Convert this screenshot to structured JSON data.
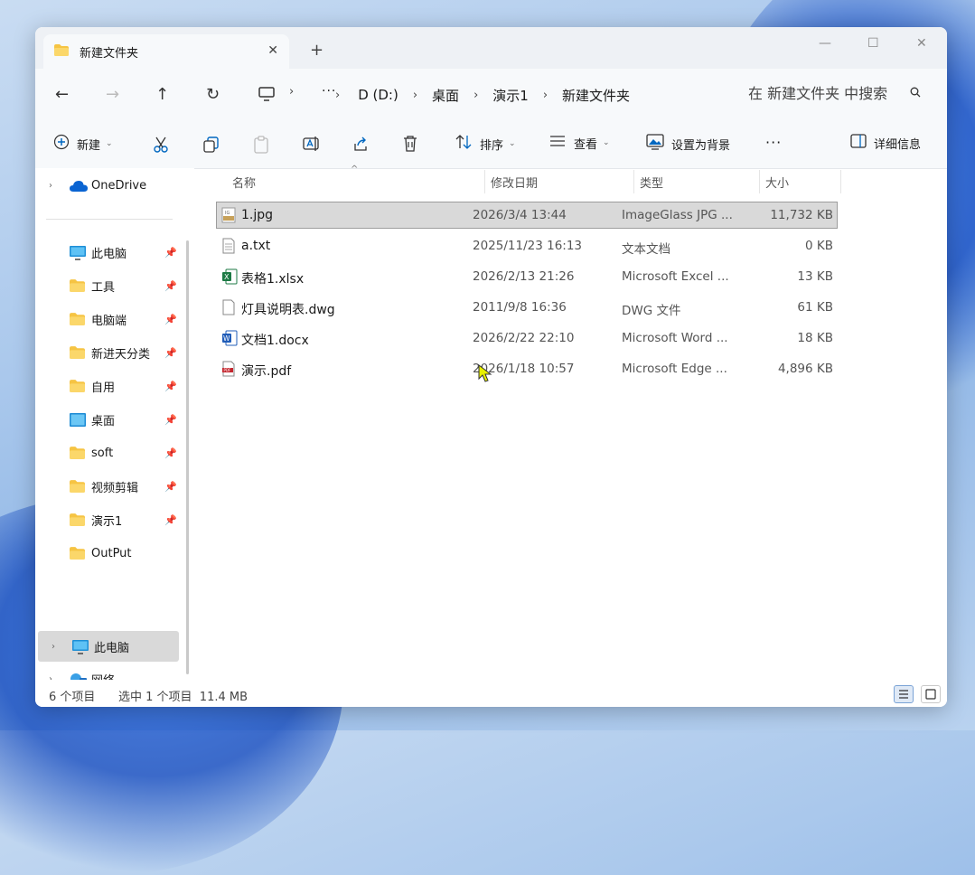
{
  "window": {
    "tab_title": "新建文件夹",
    "tab_close": "✕",
    "new_tab": "+",
    "min": "—",
    "max": "☐",
    "close": "✕"
  },
  "nav": {
    "back": "←",
    "forward": "→",
    "up": "↑",
    "refresh": "↻",
    "more": "···"
  },
  "breadcrumb": [
    "D (D:)",
    "桌面",
    "演示1",
    "新建文件夹"
  ],
  "search": {
    "placeholder": "在 新建文件夹 中搜索"
  },
  "toolbar": {
    "new_label": "新建",
    "sort_label": "排序",
    "view_label": "查看",
    "set_bg_label": "设置为背景",
    "more_label": "···",
    "details_label": "详细信息"
  },
  "sidebar": {
    "onedrive": "OneDrive",
    "quick": [
      {
        "label": "此电脑",
        "icon": "monitor-icon"
      },
      {
        "label": "工具",
        "icon": "folder-icon"
      },
      {
        "label": "电脑端",
        "icon": "folder-icon"
      },
      {
        "label": "新进天分类",
        "icon": "folder-icon"
      },
      {
        "label": "自用",
        "icon": "folder-icon"
      },
      {
        "label": "桌面",
        "icon": "desktop-icon"
      },
      {
        "label": "soft",
        "icon": "folder-icon"
      },
      {
        "label": "视频剪辑",
        "icon": "folder-icon"
      },
      {
        "label": "演示1",
        "icon": "folder-icon"
      },
      {
        "label": "OutPut",
        "icon": "folder-icon"
      }
    ],
    "this_pc": "此电脑",
    "network": "网络"
  },
  "columns": {
    "name": "名称",
    "date": "修改日期",
    "type": "类型",
    "size": "大小"
  },
  "files": [
    {
      "name": "1.jpg",
      "date": "2026/3/4 13:44",
      "type": "ImageGlass JPG ...",
      "size": "11,732 KB",
      "icon": "jpg-file-icon"
    },
    {
      "name": "a.txt",
      "date": "2025/11/23 16:13",
      "type": "文本文档",
      "size": "0 KB",
      "icon": "text-file-icon"
    },
    {
      "name": "表格1.xlsx",
      "date": "2026/2/13 21:26",
      "type": "Microsoft Excel ...",
      "size": "13 KB",
      "icon": "excel-file-icon"
    },
    {
      "name": "灯具说明表.dwg",
      "date": "2011/9/8 16:36",
      "type": "DWG 文件",
      "size": "61 KB",
      "icon": "dwg-file-icon"
    },
    {
      "name": "文档1.docx",
      "date": "2026/2/22 22:10",
      "type": "Microsoft Word ...",
      "size": "18 KB",
      "icon": "word-file-icon"
    },
    {
      "name": "演示.pdf",
      "date": "2026/1/18 10:57",
      "type": "Microsoft Edge ...",
      "size": "4,896 KB",
      "icon": "pdf-file-icon"
    }
  ],
  "status": {
    "count": "6 个项目",
    "selected": "选中 1 个项目  11.4 MB"
  },
  "colors": {
    "accent": "#0067c0",
    "selected_row": "#d9d9d9",
    "folder": "#f6c443"
  }
}
